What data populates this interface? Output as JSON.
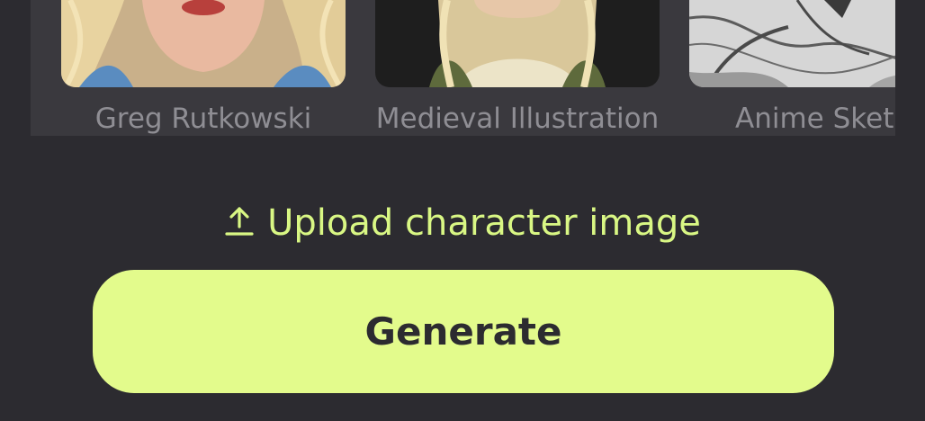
{
  "styles": [
    {
      "label": "Greg Rutkowski"
    },
    {
      "label": "Medieval Illustration"
    },
    {
      "label": "Anime Sket"
    }
  ],
  "upload": {
    "label": "Upload character image",
    "icon": "upload-icon",
    "color": "#d9f784"
  },
  "generate": {
    "label": "Generate",
    "background": "#e3fb8c"
  },
  "theme": {
    "background": "#2c2b30",
    "panel": "#3a393e",
    "label_color": "#8f8e94"
  }
}
